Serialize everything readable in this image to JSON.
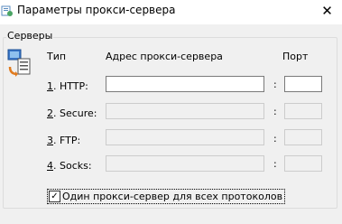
{
  "window": {
    "title": "Параметры прокси-сервера",
    "close_glyph": "✕",
    "icon": "proxy-settings-icon"
  },
  "servers": {
    "group_label": "Серверы",
    "icon": "servers-icon",
    "headers": {
      "type": "Тип",
      "address": "Адрес прокси-сервера",
      "port": "Порт"
    },
    "colon": ":",
    "rows": [
      {
        "num": "1",
        "label": ". HTTP:",
        "address": "",
        "port": "",
        "enabled": true
      },
      {
        "num": "2",
        "label": ". Secure:",
        "address": "",
        "port": "",
        "enabled": false
      },
      {
        "num": "3",
        "label": ". FTP:",
        "address": "",
        "port": "",
        "enabled": false
      },
      {
        "num": "4",
        "label": ". Socks:",
        "address": "",
        "port": "",
        "enabled": false
      }
    ],
    "same_proxy": {
      "label": "Один прокси-сервер для всех протоколов",
      "checked": true,
      "check_glyph": "✓"
    }
  }
}
